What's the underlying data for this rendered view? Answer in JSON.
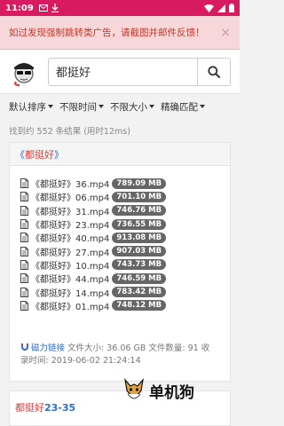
{
  "status": {
    "time": "11:09"
  },
  "alert": {
    "message": "如过发现强制跳转类广告，请截图并邮件反馈！",
    "close": "×"
  },
  "search": {
    "value": "都挺好"
  },
  "filters": [
    {
      "label": "默认排序"
    },
    {
      "label": "不限时间"
    },
    {
      "label": "不限大小"
    },
    {
      "label": "精确匹配"
    }
  ],
  "result_count": "找到约 552 条结果 (用时12ms)",
  "results": [
    {
      "title_open": "《",
      "title_keyword": "都挺好",
      "title_close": "》",
      "files": [
        {
          "prefix": "《",
          "keyword": "都挺好",
          "suffix": "》36.mp4",
          "size": "789.09 MB"
        },
        {
          "prefix": "《",
          "keyword": "都挺好",
          "suffix": "》06.mp4",
          "size": "701.10 MB"
        },
        {
          "prefix": "《",
          "keyword": "都挺好",
          "suffix": "》31.mp4",
          "size": "746.76 MB"
        },
        {
          "prefix": "《",
          "keyword": "都挺好",
          "suffix": "》23.mp4",
          "size": "736.55 MB"
        },
        {
          "prefix": "《",
          "keyword": "都挺好",
          "suffix": "》40.mp4",
          "size": "913.08 MB"
        },
        {
          "prefix": "《",
          "keyword": "都挺好",
          "suffix": "》27.mp4",
          "size": "907.03 MB"
        },
        {
          "prefix": "《",
          "keyword": "都挺好",
          "suffix": "》10.mp4",
          "size": "743.73 MB"
        },
        {
          "prefix": "《",
          "keyword": "都挺好",
          "suffix": "》44.mp4",
          "size": "746.59 MB"
        },
        {
          "prefix": "《",
          "keyword": "都挺好",
          "suffix": "》14.mp4",
          "size": "783.42 MB"
        },
        {
          "prefix": "《",
          "keyword": "都挺好",
          "suffix": "》01.mp4",
          "size": "748.12 MB"
        }
      ],
      "magnet_label": "磁力链接",
      "meta_line1": "文件大小: 36.06 GB 文件数量: 91 收",
      "meta_line2": "录时间: 2019-06-02 21:24:14"
    },
    {
      "title_keyword": "都挺好",
      "title_rest": "23-35"
    }
  ],
  "watermark": {
    "text": "单机狗"
  },
  "colors": {
    "status_bar": "#d81b60",
    "link": "#2b6cd4",
    "highlight": "#e53935",
    "alert_bg": "#f8d7da",
    "alert_text": "#c0392b"
  }
}
